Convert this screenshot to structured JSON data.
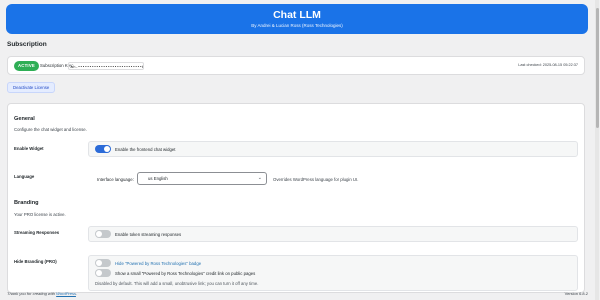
{
  "header": {
    "title": "Chat LLM",
    "subtitle": "By Andrei & Lucian Ross (Ross Technologies)"
  },
  "subscription": {
    "section_title": "Subscription",
    "status": "ACTIVE",
    "key_label": "Subscription Key:",
    "key_value": "sh-••••••••••••••••••••••••••••6Q2A",
    "last_checked": "Last checked: 2025-08-15 05:22:37",
    "deactivate_label": "Deactivate License"
  },
  "general": {
    "title": "General",
    "description": "Configure the chat widget and license.",
    "enable_widget": {
      "label": "Enable Widget",
      "toggle_text": "Enable the frontend chat widget",
      "on": true
    },
    "language": {
      "label": "Language",
      "field_label": "Interface language:",
      "selected": "us English",
      "help": "Overrides WordPress language for plugin UI."
    }
  },
  "branding": {
    "title": "Branding",
    "description": "Your PRO license is active.",
    "streaming": {
      "label": "Streaming Responses",
      "toggle_text": "Enable token streaming responses",
      "on": false
    },
    "hide_branding": {
      "label": "Hide Branding (PRO)",
      "toggle1_text": "Hide \"Powered by Ross Technologies\" badge",
      "toggle2_text": "Show a small \"Powered by Ross Technologies\" credit link on public pages",
      "note": "Disabled by default. This will add a small, unobtrusive link; you can turn it off any time."
    }
  },
  "footer": {
    "thanks_prefix": "Thank you for creating with",
    "wordpress": "WordPress",
    "thanks_suffix": ".",
    "version": "Version 6.8.2"
  },
  "colors": {
    "accent": "#1a73e8",
    "active": "#2eae55",
    "toggle_on": "#2c6bd8"
  }
}
